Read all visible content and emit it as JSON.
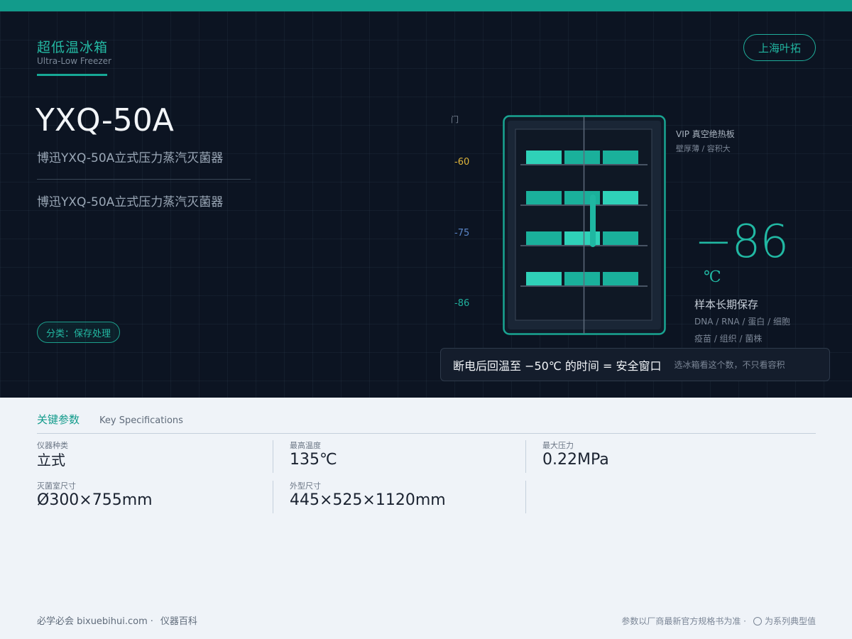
{
  "header": {
    "category_cn": "超低温冰箱",
    "category_en": "Ultra-Low Freezer",
    "brand": "上海叶拓"
  },
  "product": {
    "model": "YXQ-50A",
    "name": "博迅YXQ-50A立式压力蒸汽灭菌器",
    "description": "博迅YXQ-50A立式压力蒸汽灭菌器",
    "tag": "分类：保存处理"
  },
  "illustration": {
    "door_label": "门",
    "scale": [
      "-60",
      "-75",
      "-86"
    ],
    "insulation_title": "VIP 真空绝热板",
    "insulation_note": "壁厚薄 / 容积大",
    "temperature": "−86",
    "temperature_unit": "℃",
    "storage_title": "样本长期保存",
    "storage_line1": "DNA / RNA / 蛋白 / 细胞",
    "storage_line2": "疫苗 / 组织 / 菌株",
    "callout_main": "断电后回温至 −50℃ 的时间 = 安全窗口",
    "callout_hint": "选冰箱看这个数，不只看容积"
  },
  "specs": {
    "title": "关键参数",
    "title_en": "Key Specifications",
    "items": [
      {
        "label": "仪器种类",
        "value": "立式"
      },
      {
        "label": "最高温度",
        "value": "135℃"
      },
      {
        "label": "最大压力",
        "value": "0.22MPa"
      },
      {
        "label": "灭菌室尺寸",
        "value": "Ø300×755mm"
      },
      {
        "label": "外型尺寸",
        "value": "445×525×1120mm"
      }
    ]
  },
  "footer": {
    "site": "必学必会 bixuebihui.com",
    "dot": "·",
    "section": "仪器百科",
    "disclaimer": "参数以厂商最新官方规格书为准 ·",
    "typical": "为系列典型值"
  },
  "colors": {
    "accent": "#129b8b",
    "hero_bg": "#0c1422",
    "scale_60": "#e0b53a",
    "scale_75": "#5b86c9",
    "scale_86": "#20b09d"
  }
}
